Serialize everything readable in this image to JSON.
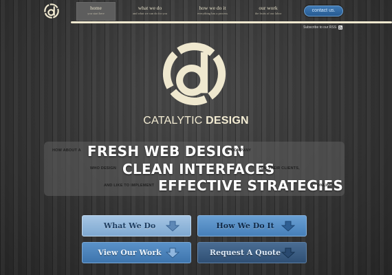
{
  "nav": {
    "items": [
      {
        "label": "home",
        "sub": "you start here"
      },
      {
        "label": "what we do",
        "sub": "and what we can do for you"
      },
      {
        "label": "how we do it",
        "sub": "everything has a process"
      },
      {
        "label": "our work",
        "sub": "the fruits of our labor"
      }
    ],
    "contact_label": "contact us."
  },
  "subscribe_text": "Subscribe to our RSS",
  "brand": {
    "light": "CATALYTIC ",
    "bold": "DESIGN"
  },
  "tagline": {
    "small_1": "HOW ABOUT A",
    "big_1": "FRESH WEB DESIGN",
    "small_1b": "COMPANY",
    "small_2": "WHO DESIGN",
    "big_2": "CLEAN INTERFACES",
    "small_2b": "FOR THEIR CLIENTS,",
    "small_3": "AND LIKE TO IMPLEMENT",
    "big_3": "EFFECTIVE STRATEGIES",
    "small_3b": "ONLINE?"
  },
  "buttons": {
    "what_we_do": "What We Do",
    "how_we_do_it": "How We Do It",
    "view_our_work": "View Our Work",
    "request_quote": "Request A Quote"
  },
  "colors": {
    "cream": "#efe8cf",
    "accent_blue": "#3f79b4",
    "background": "#3a3a3a"
  },
  "icons": [
    "catalytic-logo-icon",
    "rss-icon",
    "down-arrow-icon"
  ]
}
